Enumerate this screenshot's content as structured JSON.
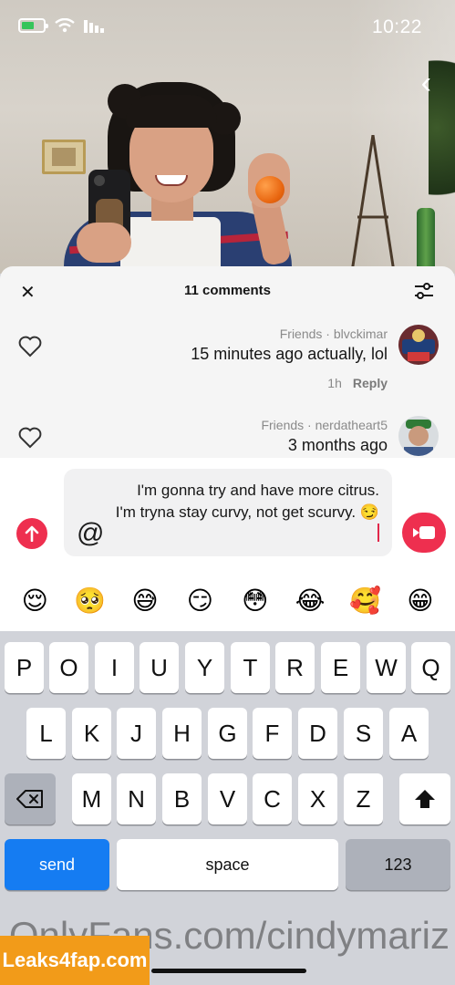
{
  "status_bar": {
    "time": "10:22"
  },
  "sheet": {
    "title": "11 comments",
    "comments": [
      {
        "username": "blvckimar",
        "relation": "Friends",
        "text": "15 minutes ago actually, lol",
        "age": "1h",
        "reply_label": "Reply"
      },
      {
        "username": "nerdatheart5",
        "relation": "Friends",
        "text": "3 months ago"
      }
    ]
  },
  "compose": {
    "text": "I'm gonna try and have more citrus. I'm tryna stay curvy, not get scurvy. 😏"
  },
  "emoji_bar": [
    "😌",
    "🥺",
    "😅",
    "😏",
    "😳",
    "😂",
    "🥰",
    "😁"
  ],
  "keyboard": {
    "row1": [
      "Q",
      "W",
      "E",
      "R",
      "T",
      "Y",
      "U",
      "I",
      "O",
      "P"
    ],
    "row2": [
      "A",
      "S",
      "D",
      "F",
      "G",
      "H",
      "J",
      "K",
      "L"
    ],
    "row3": [
      "Z",
      "X",
      "C",
      "V",
      "B",
      "N",
      "M"
    ],
    "numbers_label": "123",
    "space_label": "space",
    "send_label": "send"
  },
  "watermark": "OnlyFans.com/cindymariz",
  "badge": "Leaks4fap.com",
  "colors": {
    "accent_red": "#ee2f4f",
    "send_blue": "#157cf2"
  }
}
